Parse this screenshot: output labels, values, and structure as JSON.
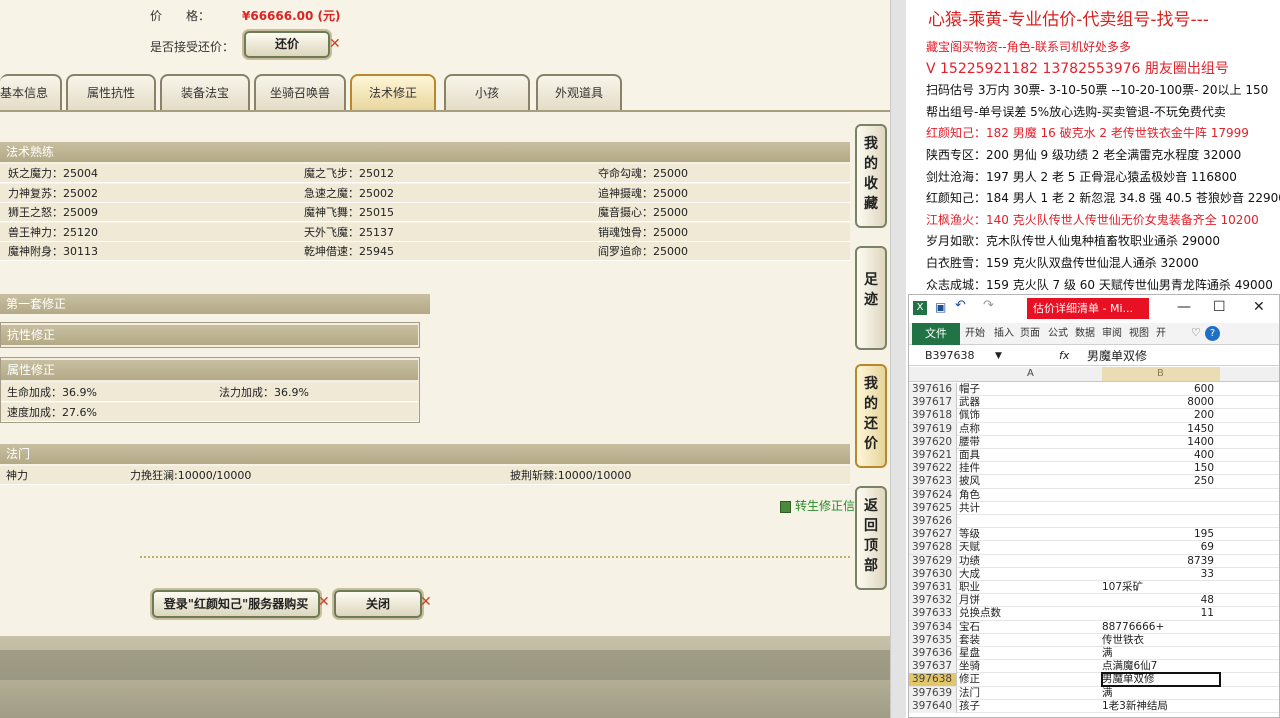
{
  "game": {
    "price_label": "价　　格：",
    "price_value": "¥66666.00 (元)",
    "bargain_label": "是否接受还价：",
    "bargain_button": "还价",
    "tabs": [
      "基本信息",
      "属性抗性",
      "装备法宝",
      "坐骑召唤兽",
      "法术修正",
      "小孩",
      "外观道具"
    ],
    "active_tab": "法术修正",
    "sect_skills": "法术熟练",
    "skills": [
      [
        "妖之魔力：25004",
        "魔之飞步：25012",
        "夺命勾魂：25000"
      ],
      [
        "力神复苏：25002",
        "急速之魔：25002",
        "追神摄魂：25000"
      ],
      [
        "狮王之怒：25009",
        "魔神飞舞：25015",
        "魔音摄心：25000"
      ],
      [
        "兽王神力：25120",
        "天外飞魔：25137",
        "销魂蚀骨：25000"
      ],
      [
        "魔神附身：30113",
        "乾坤借速：25945",
        "阎罗追命：25000"
      ]
    ],
    "sect_first": "第一套修正",
    "sect_resist": "抗性修正",
    "sect_attr": "属性修正",
    "attr": [
      "生命加成：36.9%",
      "法力加成：36.9%",
      "速度加成：27.6%"
    ],
    "sect_fa": "法门",
    "fa_row": [
      "神力",
      "力挽狂澜:10000/10000",
      "披荆斩棘:10000/10000"
    ],
    "reincarn_link": "转生修正信",
    "login_button": "登录\"红颜知己\"服务器购买",
    "close_button": "关闭",
    "side_buttons": [
      "我的收藏",
      "足迹",
      "我的还价",
      "返回顶部"
    ]
  },
  "ad": {
    "headline": "心猿-乘黄-专业估价-代卖组号-找号---",
    "lines": [
      {
        "text": "藏宝阁买物资--角色-联系司机好处多多",
        "color": "red"
      },
      {
        "text": "V 15225921182   13782553976 朋友圈出组号",
        "color": "red"
      },
      {
        "text": "扫码估号 3万内 30票- 3-10-50票  --10-20-100票- 20以上 150",
        "color": "black"
      },
      {
        "text": "帮出组号-单号误差 5%放心选购-买卖管退-不玩免费代卖",
        "color": "black"
      },
      {
        "text": "红颜知己：182 男魔 16 破克水 2 老传世铁衣金牛阵 17999",
        "color": "red"
      },
      {
        "text": "陕西专区：200 男仙 9 级功绩 2 老全满雷克水程度 32000",
        "color": "black"
      },
      {
        "text": "剑灶沧海：197 男人 2 老 5 正骨混心猿孟极妙音 116800",
        "color": "black"
      },
      {
        "text": "红颜知己：184 男人 1 老 2 新忽混 34.8 强 40.5 苍狼妙音 22900",
        "color": "black"
      },
      {
        "text": "江枫渔火：140 克火队传世人传世仙无价女鬼装备齐全 10200",
        "color": "red"
      },
      {
        "text": "岁月如歌：克木队传世人仙鬼种植畜牧职业通杀 29000",
        "color": "black"
      },
      {
        "text": "白衣胜雪：159 克火队双盘传世仙混人通杀 32000",
        "color": "black"
      },
      {
        "text": "众志成城：159 克火队 7 级 60 天赋传世仙男青龙阵通杀 49000",
        "color": "black"
      }
    ]
  },
  "excel": {
    "doc_title": "估价详细清单 - Mi...",
    "ribbon_file": "文件",
    "ribbon_tabs": [
      "开始",
      "插入",
      "页面",
      "公式",
      "数据",
      "审阅",
      "视图",
      "开"
    ],
    "name_box": "B397638",
    "formula_fx": "fx",
    "formula_value": "男魔单双修",
    "col_a": "A",
    "col_b": "B",
    "rows": [
      {
        "n": "397616",
        "a": "帽子",
        "b": "600",
        "num": true
      },
      {
        "n": "397617",
        "a": "武器",
        "b": "8000",
        "num": true
      },
      {
        "n": "397618",
        "a": "佩饰",
        "b": "200",
        "num": true
      },
      {
        "n": "397619",
        "a": "点称",
        "b": "1450",
        "num": true
      },
      {
        "n": "397620",
        "a": "腰带",
        "b": "1400",
        "num": true
      },
      {
        "n": "397621",
        "a": "面具",
        "b": "400",
        "num": true
      },
      {
        "n": "397622",
        "a": "挂件",
        "b": "150",
        "num": true
      },
      {
        "n": "397623",
        "a": "披风",
        "b": "250",
        "num": true
      },
      {
        "n": "397624",
        "a": "角色",
        "b": "",
        "num": false
      },
      {
        "n": "397625",
        "a": "共计",
        "b": "",
        "num": false
      },
      {
        "n": "397626",
        "a": "",
        "b": "",
        "num": false
      },
      {
        "n": "397627",
        "a": "等级",
        "b": "195",
        "num": true
      },
      {
        "n": "397628",
        "a": "天赋",
        "b": "69",
        "num": true
      },
      {
        "n": "397629",
        "a": "功绩",
        "b": "8739",
        "num": true
      },
      {
        "n": "397630",
        "a": "大成",
        "b": "33",
        "num": true
      },
      {
        "n": "397631",
        "a": "职业",
        "b": "107采矿",
        "num": false
      },
      {
        "n": "397632",
        "a": "月饼",
        "b": "48",
        "num": true
      },
      {
        "n": "397633",
        "a": "兑换点数",
        "b": "11",
        "num": true
      },
      {
        "n": "397634",
        "a": "宝石",
        "b": "88776666+",
        "num": false
      },
      {
        "n": "397635",
        "a": "套装",
        "b": "传世铁衣",
        "num": false
      },
      {
        "n": "397636",
        "a": "星盘",
        "b": "满",
        "num": false
      },
      {
        "n": "397637",
        "a": "坐骑",
        "b": "点满魔6仙7",
        "num": false
      },
      {
        "n": "397638",
        "a": "修正",
        "b": "男魔单双修",
        "num": false,
        "sel": true
      },
      {
        "n": "397639",
        "a": "法门",
        "b": "满",
        "num": false
      },
      {
        "n": "397640",
        "a": "孩子",
        "b": "1老3新神结局",
        "num": false
      }
    ]
  }
}
